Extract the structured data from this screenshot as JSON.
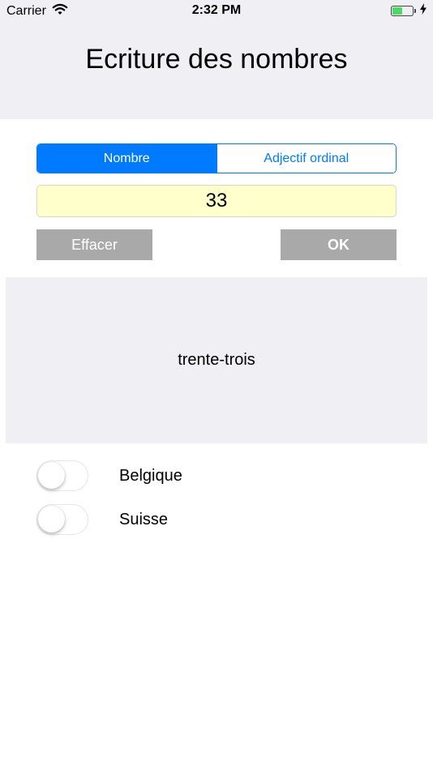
{
  "status_bar": {
    "carrier": "Carrier",
    "time": "2:32 PM",
    "battery_level": 0.5
  },
  "header": {
    "title": "Ecriture des nombres"
  },
  "segmented": {
    "options": [
      "Nombre",
      "Adjectif ordinal"
    ],
    "selected_index": 0
  },
  "input": {
    "value": "33"
  },
  "buttons": {
    "clear_label": "Effacer",
    "ok_label": "OK"
  },
  "result": {
    "text": "trente-trois"
  },
  "toggles": [
    {
      "label": "Belgique",
      "on": false
    },
    {
      "label": "Suisse",
      "on": false
    }
  ],
  "colors": {
    "accent": "#007aff",
    "input_background": "#ffffcc",
    "button_background": "#a9a9a9",
    "panel_background": "#efeff4",
    "battery": "#4cd964"
  }
}
